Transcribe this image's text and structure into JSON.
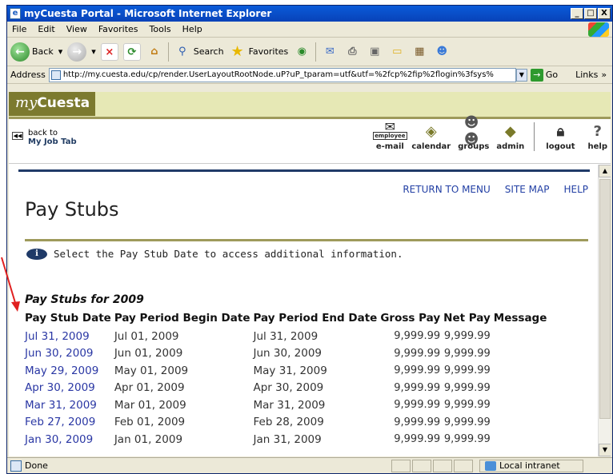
{
  "window": {
    "title": "myCuesta Portal - Microsoft Internet Explorer",
    "controls": [
      "_",
      "□",
      "X"
    ]
  },
  "menu": [
    "File",
    "Edit",
    "View",
    "Favorites",
    "Tools",
    "Help"
  ],
  "toolbar": {
    "back": "Back",
    "search": "Search",
    "favorites": "Favorites"
  },
  "address": {
    "label": "Address",
    "url": "http://my.cuesta.edu/cp/render.UserLayoutRootNode.uP?uP_tparam=utf&utf=%2fcp%2fip%2flogin%3fsys%",
    "go": "Go",
    "links": "Links"
  },
  "portal": {
    "logo_my": "my",
    "logo_name": "Cuesta",
    "back_line1": "back to",
    "back_line2": "My Job Tab",
    "nav": [
      {
        "label": "e-mail",
        "icon": "envelope-icon"
      },
      {
        "label": "calendar",
        "icon": "calendar-icon"
      },
      {
        "label": "groups",
        "icon": "groups-icon"
      },
      {
        "label": "admin",
        "icon": "admin-icon"
      },
      {
        "label": "logout",
        "icon": "lock-icon"
      },
      {
        "label": "help",
        "icon": "question-icon"
      }
    ],
    "email_tag": "employee"
  },
  "page": {
    "links": [
      "RETURN TO MENU",
      "SITE MAP",
      "HELP"
    ],
    "title": "Pay Stubs",
    "info": "Select the Pay Stub Date to access additional information.",
    "section_title": "Pay Stubs for 2009",
    "columns": [
      "Pay Stub Date",
      "Pay Period Begin Date",
      "Pay Period End Date",
      "Gross Pay",
      "Net Pay",
      "Message"
    ],
    "rows": [
      {
        "date": "Jul 31, 2009",
        "begin": "Jul 01, 2009",
        "end": "Jul 31, 2009",
        "gross": "9,999.99",
        "net": "9,999.99",
        "message": ""
      },
      {
        "date": "Jun 30, 2009",
        "begin": "Jun 01, 2009",
        "end": "Jun 30, 2009",
        "gross": "9,999.99",
        "net": "9,999.99",
        "message": ""
      },
      {
        "date": "May 29, 2009",
        "begin": "May 01, 2009",
        "end": "May 31, 2009",
        "gross": "9,999.99",
        "net": "9,999.99",
        "message": ""
      },
      {
        "date": "Apr 30, 2009",
        "begin": "Apr 01, 2009",
        "end": "Apr 30, 2009",
        "gross": "9,999.99",
        "net": "9,999.99",
        "message": ""
      },
      {
        "date": "Mar 31, 2009",
        "begin": "Mar 01, 2009",
        "end": "Mar 31, 2009",
        "gross": "9,999.99",
        "net": "9,999.99",
        "message": ""
      },
      {
        "date": "Feb 27, 2009",
        "begin": "Feb 01, 2009",
        "end": "Feb 28, 2009",
        "gross": "9,999.99",
        "net": "9,999.99",
        "message": ""
      },
      {
        "date": "Jan 30, 2009",
        "begin": "Jan 01, 2009",
        "end": "Jan 31, 2009",
        "gross": "9,999.99",
        "net": "9,999.99",
        "message": ""
      }
    ]
  },
  "status": {
    "left": "Done",
    "zone": "Local intranet"
  },
  "colors": {
    "link": "#2a37a4",
    "olive": "#9e9a5b",
    "navy": "#1f3a68",
    "arrow": "#e02020"
  }
}
